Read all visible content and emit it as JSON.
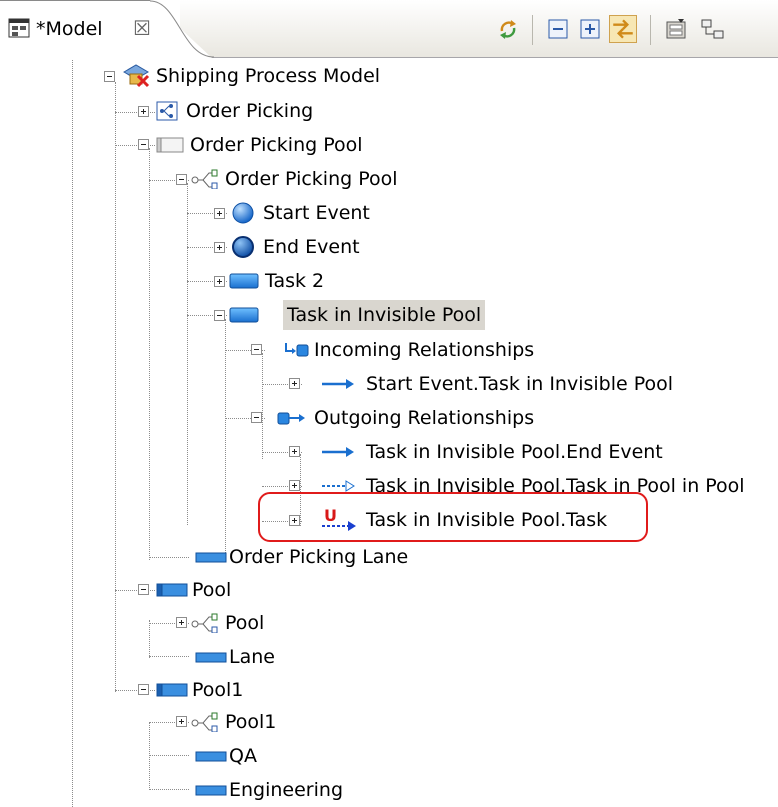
{
  "editor": {
    "tab_title": "*Model",
    "close_glyph": "☒"
  },
  "toolbar": {
    "buttons": [
      {
        "icon": "sync-icon"
      },
      {
        "icon": "collapse-all-icon"
      },
      {
        "icon": "expand-all-icon"
      },
      {
        "icon": "link-with-editor-icon",
        "pressed": true
      },
      {
        "icon": "filter-icon"
      },
      {
        "icon": "tree-layout-icon"
      }
    ]
  },
  "tree": {
    "root": "Shipping Process Model",
    "items": [
      {
        "label": "Order Picking",
        "icon": "process-icon",
        "expanded": false
      },
      {
        "label": "Order Picking Pool",
        "icon": "pool-icon",
        "expanded": true
      },
      {
        "label": "Order Picking Pool",
        "icon": "process-icon",
        "expanded": true
      },
      {
        "label": "Start Event",
        "icon": "start-event-icon",
        "expanded": false
      },
      {
        "label": "End Event",
        "icon": "end-event-icon",
        "expanded": false
      },
      {
        "label": "Task 2",
        "icon": "task-icon",
        "expanded": false
      },
      {
        "label": "Task in Invisible Pool",
        "icon": "task-icon",
        "expanded": true,
        "selected": true
      },
      {
        "label": "Incoming Relationships",
        "icon": "incoming-relationships-icon",
        "expanded": true
      },
      {
        "label": "Start Event.Task in Invisible Pool",
        "icon": "sequence-flow-icon",
        "expanded": false
      },
      {
        "label": "Outgoing Relationships",
        "icon": "outgoing-relationships-icon",
        "expanded": true
      },
      {
        "label": "Task in Invisible Pool.End Event",
        "icon": "sequence-flow-icon",
        "expanded": false
      },
      {
        "label": "Task in Invisible Pool.Task in Pool in Pool",
        "icon": "message-flow-icon",
        "expanded": false
      },
      {
        "label": "Task in Invisible Pool.Task",
        "icon": "unresolved-flow-icon",
        "marker": "U",
        "expanded": false,
        "highlighted": true
      },
      {
        "label": "Order Picking Lane",
        "icon": "lane-icon"
      },
      {
        "label": "Pool",
        "icon": "pool-icon",
        "expanded": true
      },
      {
        "label": "Pool",
        "icon": "process-icon",
        "expanded": false
      },
      {
        "label": "Lane",
        "icon": "lane-icon"
      },
      {
        "label": "Pool1",
        "icon": "pool-icon",
        "expanded": true
      },
      {
        "label": "Pool1",
        "icon": "process-icon",
        "expanded": false
      },
      {
        "label": "QA",
        "icon": "lane-icon"
      },
      {
        "label": "Engineering",
        "icon": "lane-icon"
      }
    ]
  },
  "colors": {
    "highlight_box": "#e01b1b",
    "selection": "#d9d6cf",
    "connector": "#8c8c8c",
    "task_blue": "#1f78d1"
  }
}
